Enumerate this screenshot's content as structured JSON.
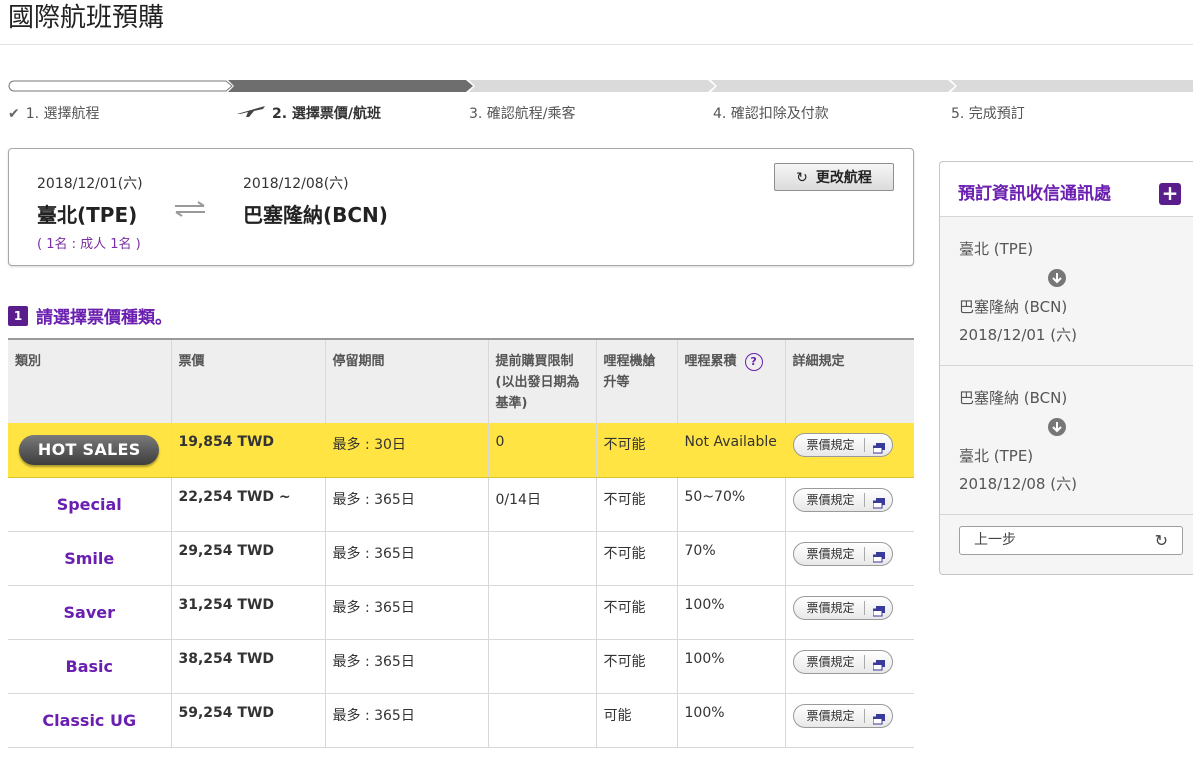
{
  "page": {
    "title": "國際航班預購"
  },
  "steps": [
    {
      "label": "1. 選擇航程",
      "icon": "check-icon"
    },
    {
      "label": "2. 選擇票價/航班",
      "icon": "airplane-icon"
    },
    {
      "label": "3. 確認航程/乘客"
    },
    {
      "label": "4. 確認扣除及付款"
    },
    {
      "label": "5. 完成預訂"
    }
  ],
  "trip": {
    "depart_date": "2018/12/01(六)",
    "return_date": "2018/12/08(六)",
    "origin": "臺北(TPE)",
    "destination": "巴塞隆納(BCN)",
    "passengers": "( 1名 : 成人 1名 )",
    "change_label": "更改航程"
  },
  "section": {
    "number": "1",
    "title": "請選擇票價種類。"
  },
  "fare_table": {
    "headers": {
      "type": "類別",
      "price": "票價",
      "stay": "停留期間",
      "advance_line1": "提前購買限制",
      "advance_line2": "(以出發日期為",
      "advance_line3": "基準)",
      "upgrade_line1": "哩程機艙",
      "upgrade_line2": "升等",
      "mileage": "哩程累積",
      "rules": "詳細規定"
    },
    "rule_button_label": "票價規定",
    "rows": [
      {
        "type": "HOT SALES",
        "price": "19,854 TWD",
        "stay": "最多 : 30日",
        "advance": "0",
        "upgrade": "不可能",
        "mileage": "Not Available"
      },
      {
        "type": "Special",
        "price": "22,254 TWD ~",
        "stay": "最多 : 365日",
        "advance": "0/14日",
        "upgrade": "不可能",
        "mileage": "50~70%"
      },
      {
        "type": "Smile",
        "price": "29,254 TWD",
        "stay": "最多 : 365日",
        "advance": "",
        "upgrade": "不可能",
        "mileage": "70%"
      },
      {
        "type": "Saver",
        "price": "31,254 TWD",
        "stay": "最多 : 365日",
        "advance": "",
        "upgrade": "不可能",
        "mileage": "100%"
      },
      {
        "type": "Basic",
        "price": "38,254 TWD",
        "stay": "最多 : 365日",
        "advance": "",
        "upgrade": "不可能",
        "mileage": "100%"
      },
      {
        "type": "Classic UG",
        "price": "59,254 TWD",
        "stay": "最多 : 365日",
        "advance": "",
        "upgrade": "可能",
        "mileage": "100%"
      }
    ]
  },
  "sidebar": {
    "title": "預訂資訊收信通訊處",
    "segments": [
      {
        "from": "臺北 (TPE)",
        "to": "巴塞隆納 (BCN)",
        "date": "2018/12/01 (六)"
      },
      {
        "from": "巴塞隆納 (BCN)",
        "to": "臺北 (TPE)",
        "date": "2018/12/08 (六)"
      }
    ],
    "back_label": "上一步"
  },
  "colors": {
    "accent": "#6a1fb0",
    "hot_row": "#ffe443",
    "badge": "#5a1e8c"
  }
}
